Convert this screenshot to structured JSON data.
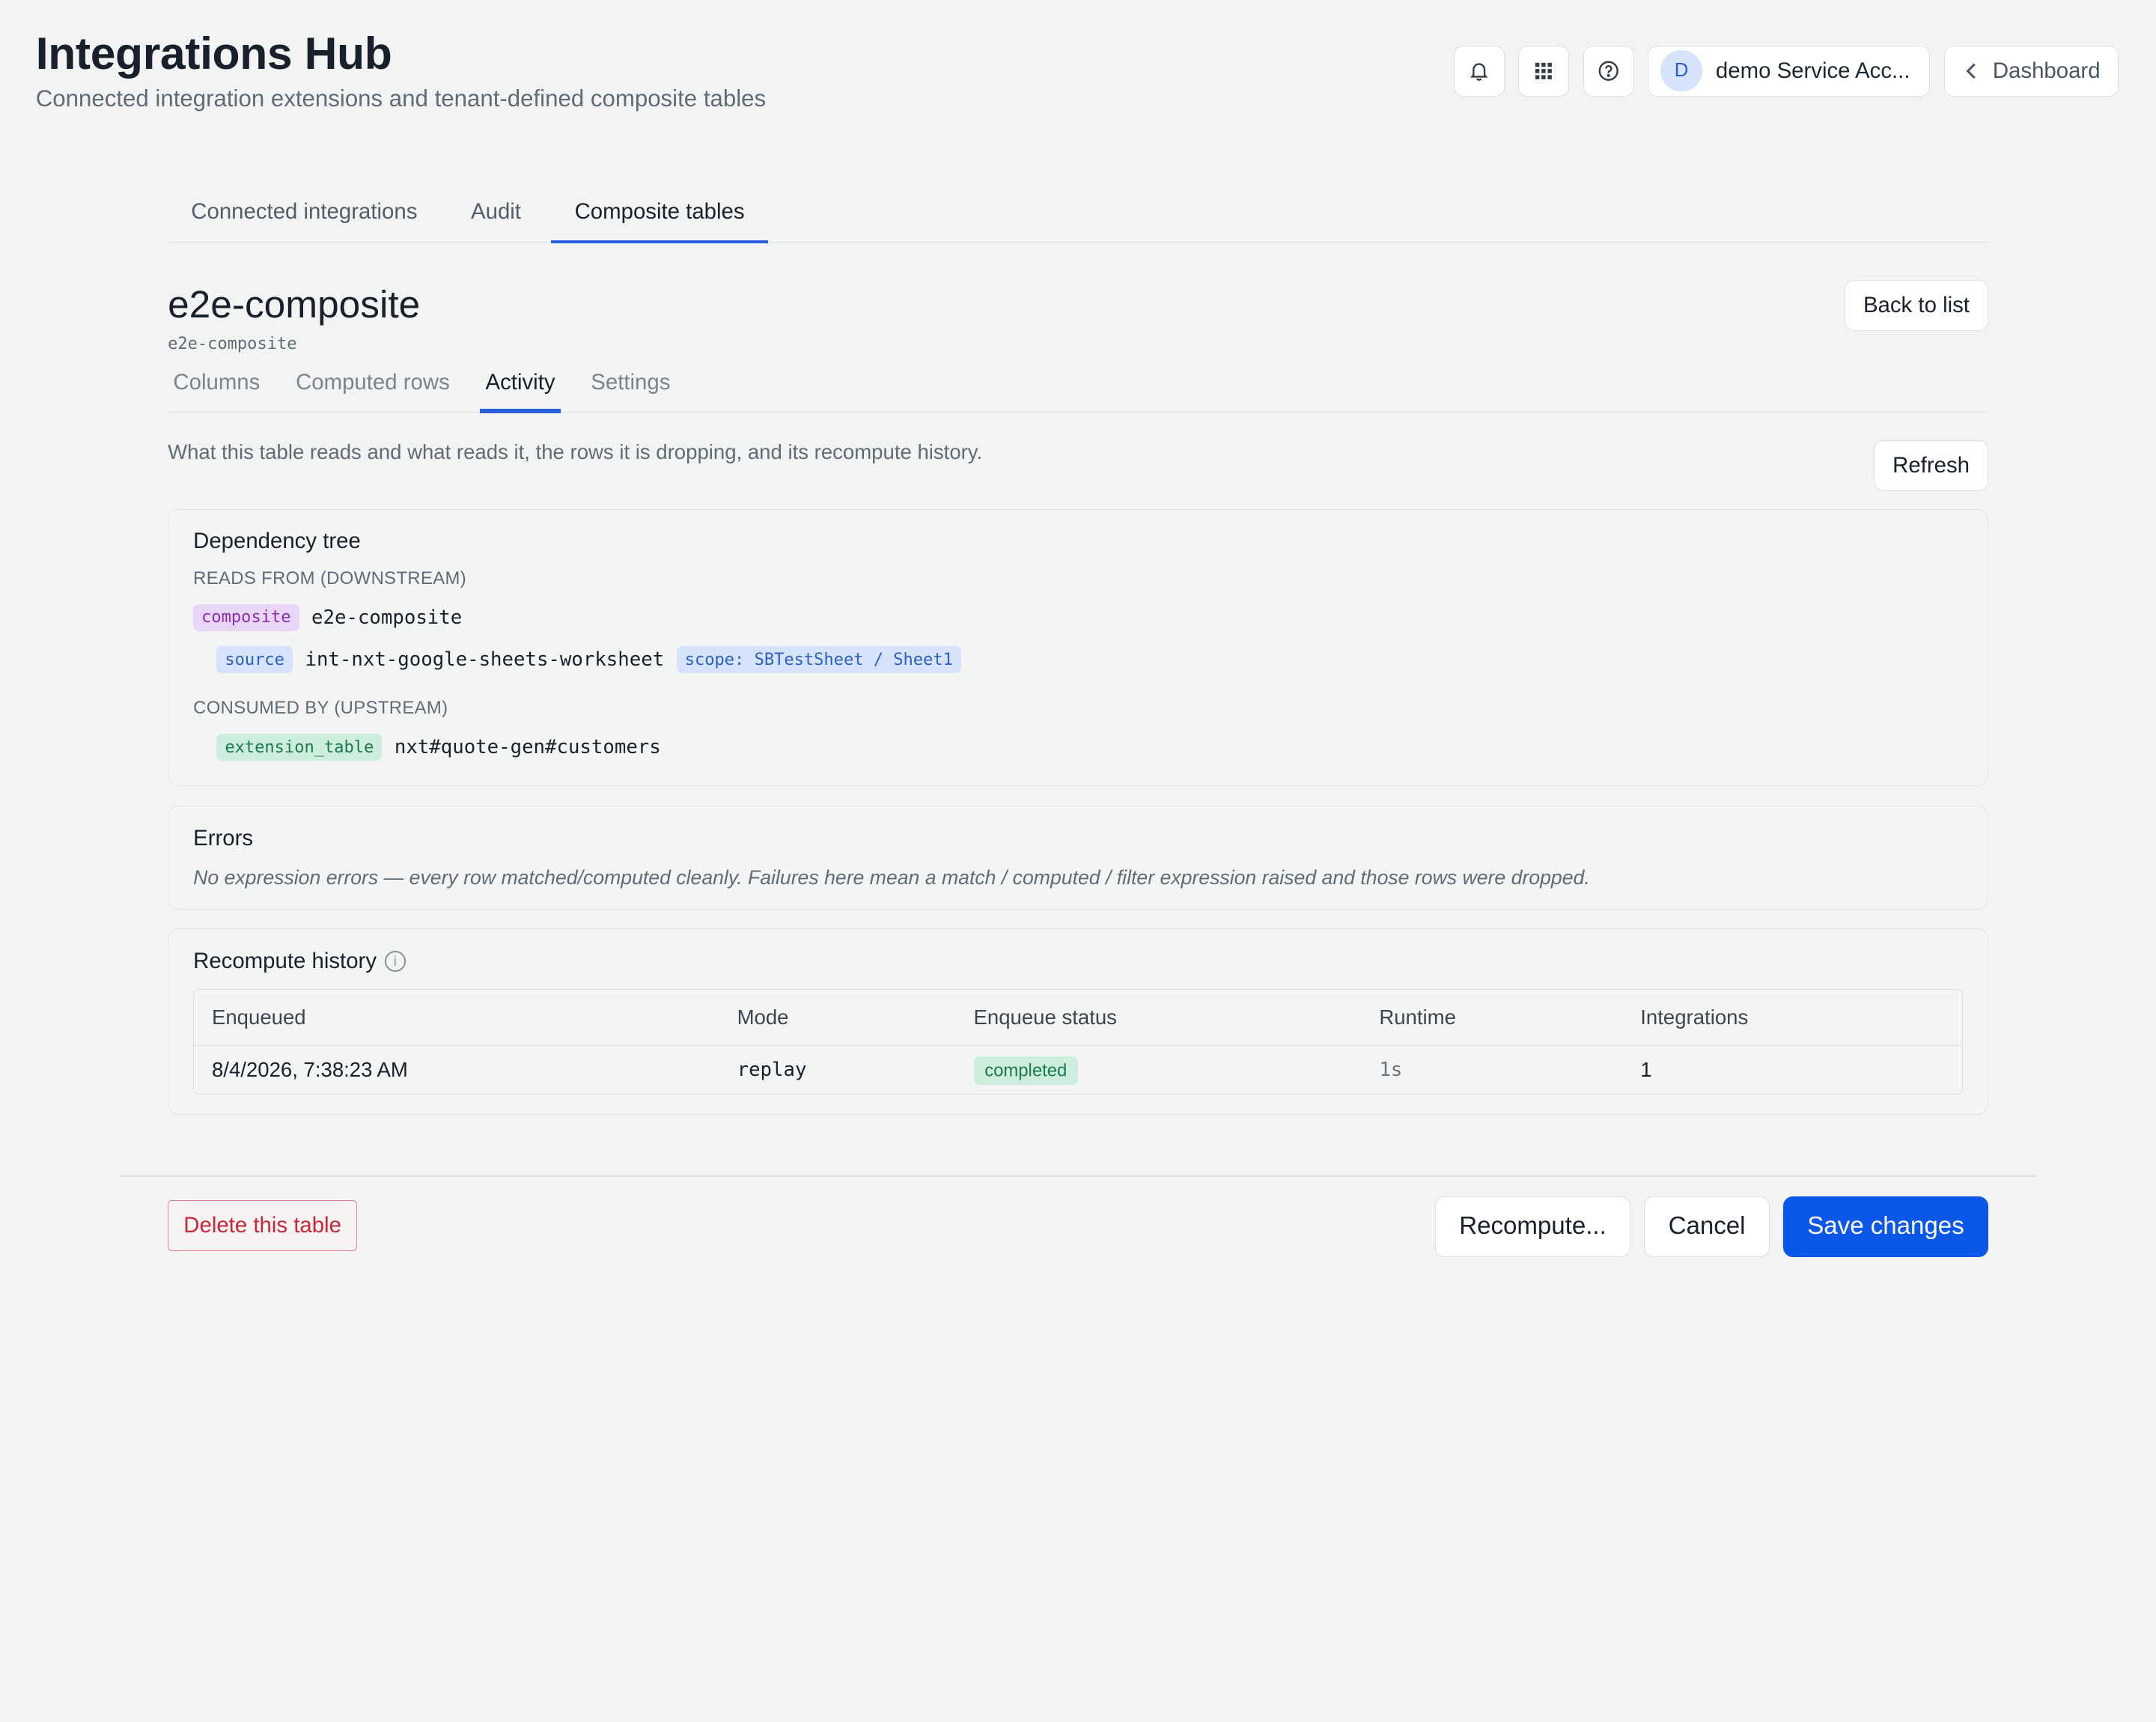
{
  "header": {
    "title": "Integrations Hub",
    "subtitle": "Connected integration extensions and tenant-defined composite tables",
    "account_initial": "D",
    "account_label": "demo Service Acc...",
    "dashboard_label": "Dashboard"
  },
  "main_tabs": [
    {
      "label": "Connected integrations"
    },
    {
      "label": "Audit"
    },
    {
      "label": "Composite tables",
      "active": true
    }
  ],
  "detail": {
    "title": "e2e-composite",
    "slug": "e2e-composite",
    "back_label": "Back to list"
  },
  "sub_tabs": [
    {
      "label": "Columns"
    },
    {
      "label": "Computed rows"
    },
    {
      "label": "Activity",
      "active": true
    },
    {
      "label": "Settings"
    }
  ],
  "activity": {
    "intro": "What this table reads and what reads it, the rows it is dropping, and its recompute history.",
    "refresh_label": "Refresh"
  },
  "dependency_tree": {
    "title": "Dependency tree",
    "reads_label": "READS FROM (DOWNSTREAM)",
    "root": {
      "badge": "composite",
      "name": "e2e-composite"
    },
    "source": {
      "badge": "source",
      "name": "int-nxt-google-sheets-worksheet",
      "scope": "scope: SBTestSheet / Sheet1"
    },
    "consumed_label": "CONSUMED BY (UPSTREAM)",
    "consumer": {
      "badge": "extension_table",
      "name": "nxt#quote-gen#customers"
    }
  },
  "errors": {
    "title": "Errors",
    "text": "No expression errors — every row matched/computed cleanly. Failures here mean a match / computed / filter expression raised and those rows were dropped."
  },
  "recompute_history": {
    "title": "Recompute history",
    "columns": [
      "Enqueued",
      "Mode",
      "Enqueue status",
      "Runtime",
      "Integrations"
    ],
    "rows": [
      {
        "enqueued": "8/4/2026, 7:38:23 AM",
        "mode": "replay",
        "status": "completed",
        "runtime": "1s",
        "integrations": "1"
      }
    ]
  },
  "footer": {
    "delete_label": "Delete this table",
    "recompute_label": "Recompute...",
    "cancel_label": "Cancel",
    "save_label": "Save changes"
  },
  "colors": {
    "primary": "#0b57e8",
    "danger": "#c8263a",
    "success_bg": "#cdeedd",
    "accent_tab": "#2b5fd9"
  }
}
